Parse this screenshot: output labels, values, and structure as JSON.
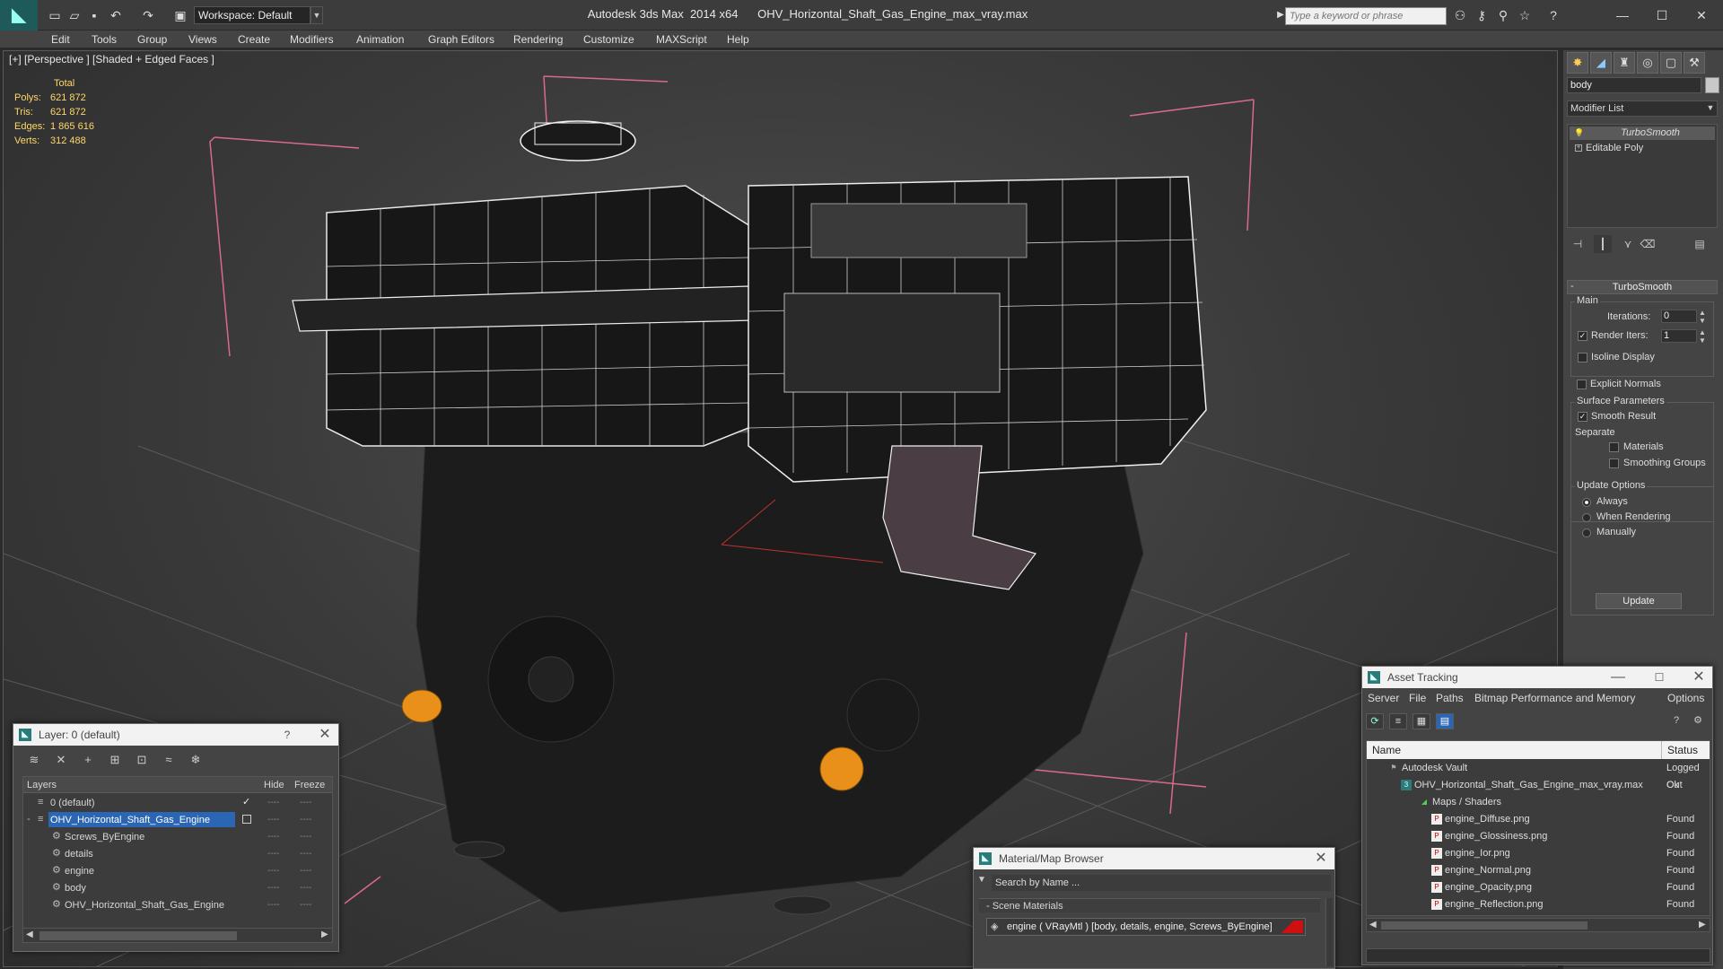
{
  "titlebar": {
    "title": "Autodesk 3ds Max  2014 x64      OHV_Horizontal_Shaft_Gas_Engine_max_vray.max",
    "workspace": "Workspace: Default",
    "search_placeholder": "Type a keyword or phrase"
  },
  "menu": [
    "Edit",
    "Tools",
    "Group",
    "Views",
    "Create",
    "Modifiers",
    "Animation",
    "Graph Editors",
    "Rendering",
    "Customize",
    "MAXScript",
    "Help"
  ],
  "viewport": {
    "label": "[+] [Perspective ] [Shaded + Edged Faces ]",
    "stats_total": "Total",
    "stats": [
      {
        "k": "Polys:",
        "v": "621 872"
      },
      {
        "k": "Tris:",
        "v": "621 872"
      },
      {
        "k": "Edges:",
        "v": "1 865 616"
      },
      {
        "k": "Verts:",
        "v": "312 488"
      }
    ]
  },
  "cmdpanel": {
    "object_name": "body",
    "modifier_list": "Modifier List",
    "stack": [
      "TurboSmooth",
      "Editable Poly"
    ],
    "rollout": "TurboSmooth",
    "main_group": "Main",
    "iterations_label": "Iterations:",
    "iterations": "0",
    "render_iters_label": "Render Iters:",
    "render_iters": "1",
    "isoline": "Isoline Display",
    "explicit": "Explicit Normals",
    "surface_group": "Surface Parameters",
    "smooth_result": "Smooth Result",
    "separate": "Separate",
    "materials": "Materials",
    "smoothing_groups": "Smoothing Groups",
    "update_group": "Update Options",
    "always": "Always",
    "when_rendering": "When Rendering",
    "manually": "Manually",
    "update": "Update"
  },
  "layers": {
    "title": "Layer: 0 (default)",
    "help": "?",
    "col_layers": "Layers",
    "col_hide": "Hide",
    "col_freeze": "Freeze",
    "rows": [
      "0 (default)",
      "OHV_Horizontal_Shaft_Gas_Engine",
      "Screws_ByEngine",
      "details",
      "engine",
      "body",
      "OHV_Horizontal_Shaft_Gas_Engine"
    ]
  },
  "material_browser": {
    "title": "Material/Map Browser",
    "search": "Search by Name ...",
    "section": "- Scene Materials",
    "item": "engine  ( VRayMtl )  [body, details, engine, Screws_ByEngine]"
  },
  "asset_tracking": {
    "title": "Asset Tracking",
    "menu": [
      "Server",
      "File",
      "Paths",
      "Bitmap Performance and Memory",
      "Options"
    ],
    "col_name": "Name",
    "col_status": "Status",
    "rows": [
      {
        "name": "Autodesk Vault",
        "status": "Logged Out"
      },
      {
        "name": "OHV_Horizontal_Shaft_Gas_Engine_max_vray.max",
        "status": "Ok"
      },
      {
        "name": "Maps / Shaders",
        "status": ""
      },
      {
        "name": "engine_Diffuse.png",
        "status": "Found"
      },
      {
        "name": "engine_Glossiness.png",
        "status": "Found"
      },
      {
        "name": "engine_Ior.png",
        "status": "Found"
      },
      {
        "name": "engine_Normal.png",
        "status": "Found"
      },
      {
        "name": "engine_Opacity.png",
        "status": "Found"
      },
      {
        "name": "engine_Reflection.png",
        "status": "Found"
      }
    ]
  }
}
